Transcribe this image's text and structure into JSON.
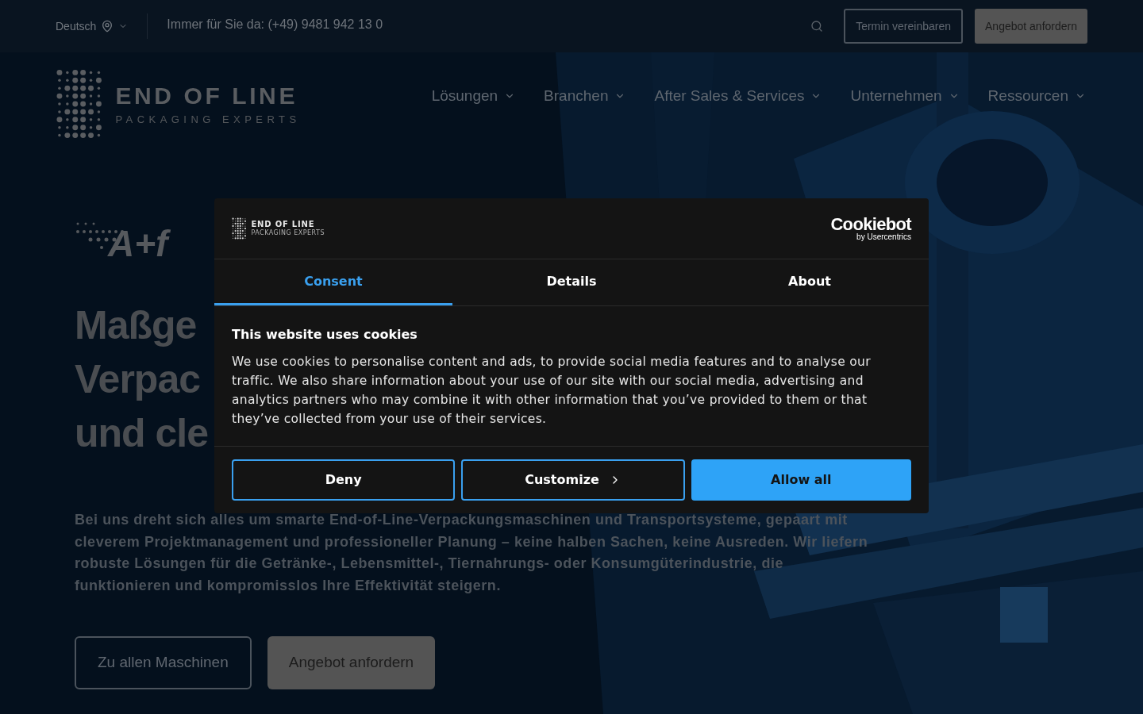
{
  "top_bar": {
    "language": "Deutsch",
    "phone": "Immer für Sie da: (+49) 9481 942 13 0",
    "buttons": [
      {
        "label": "Termin vereinbaren",
        "kind": "outline"
      },
      {
        "label": "Angebot anfordern",
        "kind": "filled"
      }
    ]
  },
  "brand": {
    "name": "END OF LINE",
    "tagline": "PACKAGING EXPERTS"
  },
  "nav": {
    "items": [
      "Lösungen",
      "Branchen",
      "After Sales & Services",
      "Unternehmen",
      "Ressourcen"
    ]
  },
  "hero": {
    "partner_logo": "A+f",
    "heading_lines": [
      "Maßge",
      "Verpac",
      "und cle"
    ],
    "text": "Bei uns dreht sich alles um smarte End-of-Line-Verpackungsmaschinen und Transportsysteme, gepaart mit cleverem Projektmanagement und professioneller Planung – keine halben Sachen, keine Ausreden. Wir liefern robuste Lösungen für die Getränke-, Lebensmittel-, Tiernahrungs- oder Konsumgüterindustrie, die funktionieren und kompromisslos Ihre Effektivität steigern.",
    "buttons": [
      {
        "label": "Zu allen Maschinen",
        "kind": "outline"
      },
      {
        "label": "Angebot anfordern",
        "kind": "filled"
      }
    ]
  },
  "cookie_dialog": {
    "brand": {
      "name": "END OF LINE",
      "tagline": "PACKAGING EXPERTS"
    },
    "provider": {
      "name": "Cookiebot",
      "by": "by Usercentrics"
    },
    "tabs": [
      {
        "label": "Consent",
        "selected": true
      },
      {
        "label": "Details",
        "selected": false
      },
      {
        "label": "About",
        "selected": false
      }
    ],
    "title": "This website uses cookies",
    "body": "We use cookies to personalise content and ads, to provide social media features and to analyse our traffic. We also share information about your use of our site with our social media, advertising and analytics partners who may combine it with other information that you’ve provided to them or that they’ve collected from your use of their services.",
    "buttons": [
      {
        "label": "Deny",
        "kind": "outline"
      },
      {
        "label": "Customize",
        "kind": "outline_chevron"
      },
      {
        "label": "Allow all",
        "kind": "primary"
      }
    ]
  }
}
